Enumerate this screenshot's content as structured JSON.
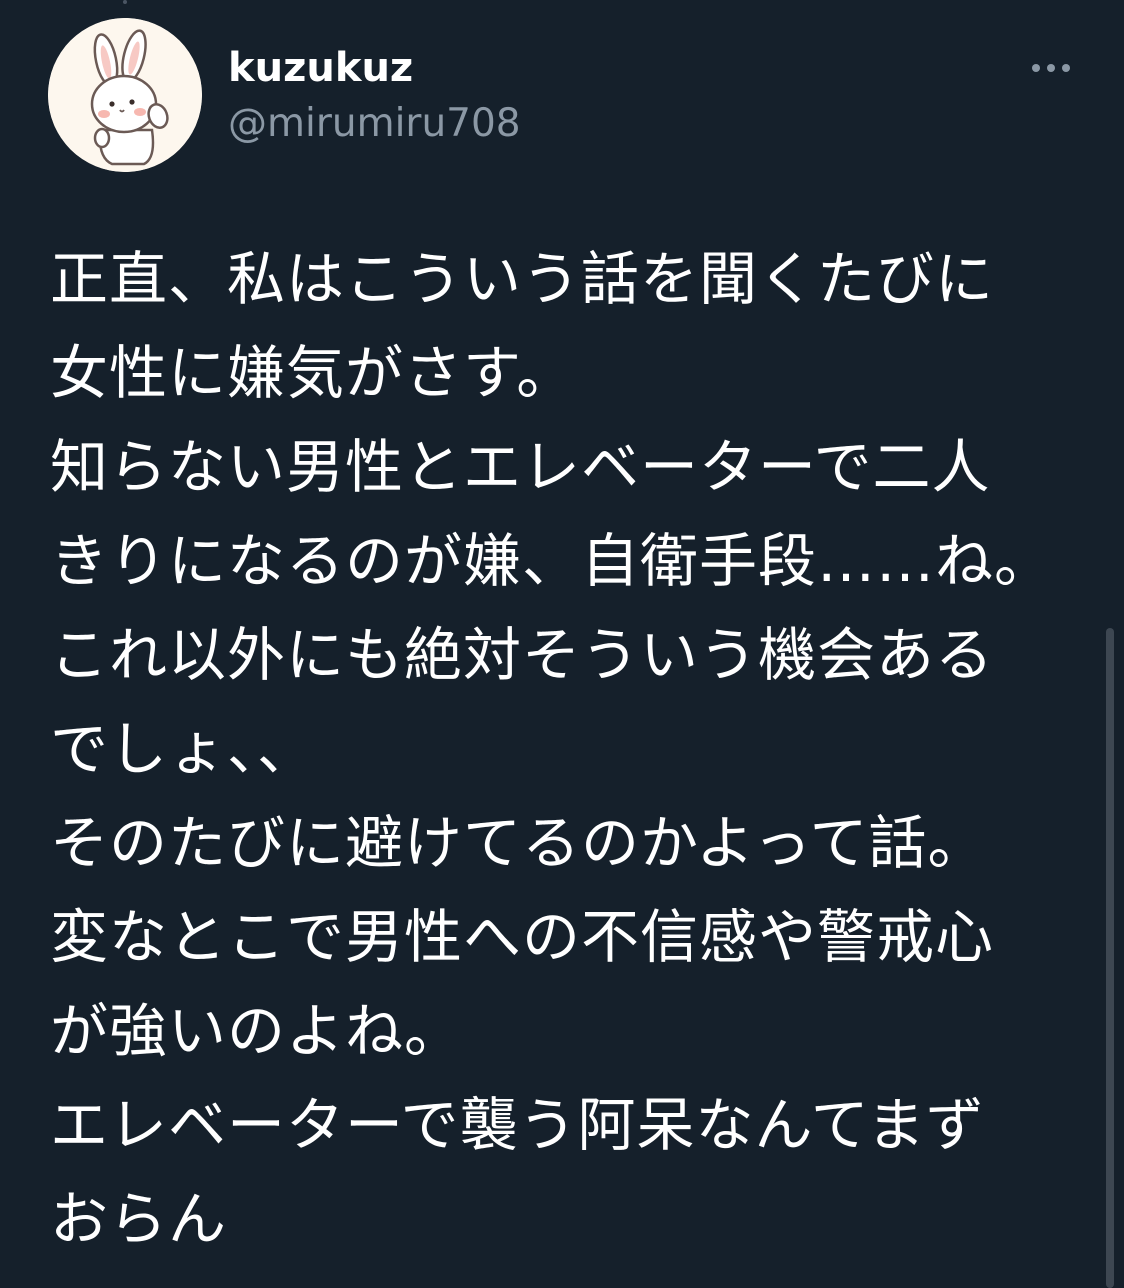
{
  "tweet": {
    "author": {
      "display_name": "kuzukuz",
      "handle": "@mirumiru708",
      "avatar_icon": "rabbit-icon"
    },
    "more_icon": "more-horizontal-icon",
    "lines": [
      "正直、私はこういう話を聞くたびに",
      "女性に嫌気がさす。",
      "知らない男性とエレベーターで二人",
      "きりになるのが嫌、自衛手段……ね。",
      "これ以外にも絶対そういう機会ある",
      "でしょ、、",
      "そのたびに避けてるのかよって話。",
      "変なとこで男性への不信感や警戒心",
      "が強いのよね。",
      "エレベーターで襲う阿呆なんてまず",
      "おらん"
    ]
  },
  "colors": {
    "background": "#15202b",
    "text_primary": "#ffffff",
    "text_secondary": "#8b98a5"
  }
}
